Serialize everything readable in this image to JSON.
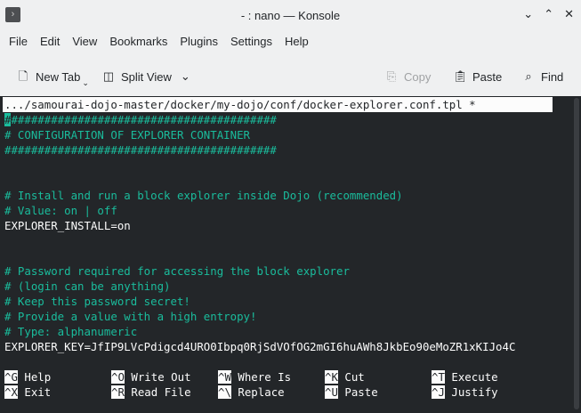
{
  "window": {
    "title": "- : nano — Konsole",
    "app_icon": "terminal-icon",
    "controls": [
      "⌄",
      "⌃",
      "✕"
    ]
  },
  "menu": [
    "File",
    "Edit",
    "View",
    "Bookmarks",
    "Plugins",
    "Settings",
    "Help"
  ],
  "toolbar": {
    "new_tab": "New Tab",
    "split_view": "Split View",
    "copy": "Copy",
    "paste": "Paste",
    "find": "Find"
  },
  "nano": {
    "filename": ".../samourai-dojo-master/docker/my-dojo/conf/docker-explorer.conf.tpl *",
    "lines": [
      {
        "t": "#########################################",
        "c": true
      },
      {
        "t": "# CONFIGURATION OF EXPLORER CONTAINER",
        "c": true
      },
      {
        "t": "#########################################",
        "c": true
      },
      {
        "t": "",
        "c": false
      },
      {
        "t": "",
        "c": false
      },
      {
        "t": "# Install and run a block explorer inside Dojo (recommended)",
        "c": true
      },
      {
        "t": "# Value: on | off",
        "c": true
      },
      {
        "t": "EXPLORER_INSTALL=on",
        "c": false
      },
      {
        "t": "",
        "c": false
      },
      {
        "t": "",
        "c": false
      },
      {
        "t": "# Password required for accessing the block explorer",
        "c": true
      },
      {
        "t": "# (login can be anything)",
        "c": true
      },
      {
        "t": "# Keep this password secret!",
        "c": true
      },
      {
        "t": "# Provide a value with a high entropy!",
        "c": true
      },
      {
        "t": "# Type: alphanumeric",
        "c": true
      },
      {
        "t": "EXPLORER_KEY=JfIP9LVcPdigcd4URO0Ibpq0RjSdVOfOG2mGI6huAWh8JkbEo90eMoZR1xKIJo4C",
        "c": false
      }
    ],
    "shortcuts": [
      [
        {
          "k": "^G",
          "l": "Help"
        },
        {
          "k": "^O",
          "l": "Write Out"
        },
        {
          "k": "^W",
          "l": "Where Is"
        },
        {
          "k": "^K",
          "l": "Cut"
        },
        {
          "k": "^T",
          "l": "Execute"
        }
      ],
      [
        {
          "k": "^X",
          "l": "Exit"
        },
        {
          "k": "^R",
          "l": "Read File"
        },
        {
          "k": "^\\",
          "l": "Replace"
        },
        {
          "k": "^U",
          "l": "Paste"
        },
        {
          "k": "^J",
          "l": "Justify"
        }
      ]
    ]
  }
}
